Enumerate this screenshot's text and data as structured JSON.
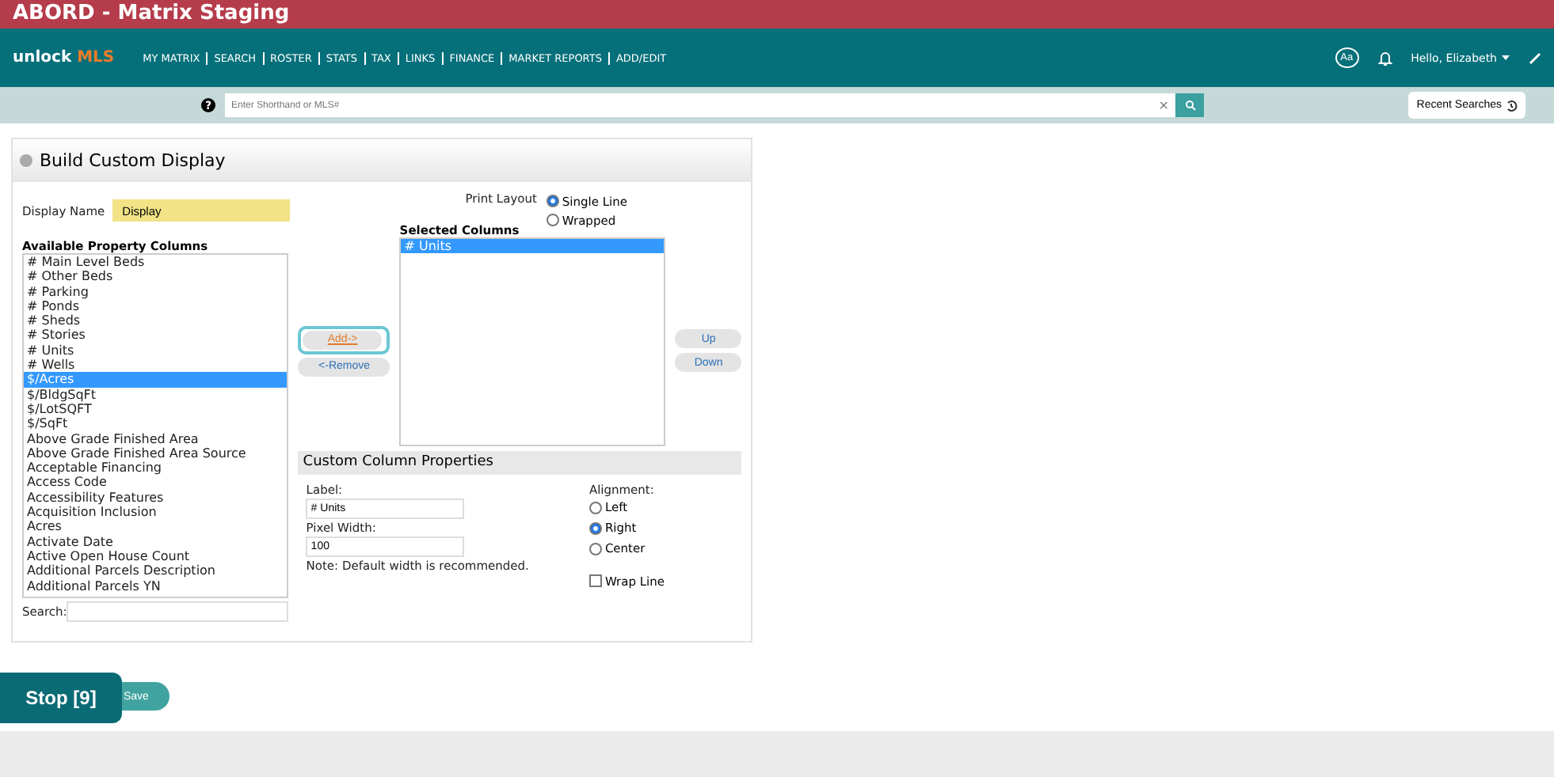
{
  "window": {
    "title": "ABORD - Matrix Staging"
  },
  "nav": {
    "logo_main": "unlock",
    "logo_accent": "MLS",
    "items": [
      "MY MATRIX",
      "SEARCH",
      "ROSTER",
      "STATS",
      "TAX",
      "LINKS",
      "FINANCE",
      "MARKET REPORTS",
      "ADD/EDIT"
    ],
    "font_button": "Aa",
    "user": "Hello, Elizabeth"
  },
  "search": {
    "help": "?",
    "placeholder": "Enter Shorthand or MLS#",
    "clear": "×",
    "recent": "Recent Searches"
  },
  "panel": {
    "title": "Build Custom Display",
    "display_name_label": "Display Name",
    "display_name": "Display",
    "print_layout_label": "Print Layout",
    "print_layouts": [
      {
        "label": "Single Line",
        "selected": true
      },
      {
        "label": "Wrapped",
        "selected": false
      }
    ],
    "available_label": "Available Property Columns",
    "available": [
      {
        "label": "# Main Level Beds",
        "selected": false
      },
      {
        "label": "# Other Beds",
        "selected": false
      },
      {
        "label": "# Parking",
        "selected": false
      },
      {
        "label": "# Ponds",
        "selected": false
      },
      {
        "label": "# Sheds",
        "selected": false
      },
      {
        "label": "# Stories",
        "selected": false
      },
      {
        "label": "# Units",
        "selected": false
      },
      {
        "label": "# Wells",
        "selected": false
      },
      {
        "label": "$/Acres",
        "selected": true
      },
      {
        "label": "$/BldgSqFt",
        "selected": false
      },
      {
        "label": "$/LotSQFT",
        "selected": false
      },
      {
        "label": "$/SqFt",
        "selected": false
      },
      {
        "label": "Above Grade Finished Area",
        "selected": false
      },
      {
        "label": "Above Grade Finished Area Source",
        "selected": false
      },
      {
        "label": "Acceptable Financing",
        "selected": false
      },
      {
        "label": "Access Code",
        "selected": false
      },
      {
        "label": "Accessibility Features",
        "selected": false
      },
      {
        "label": "Acquisition Inclusion",
        "selected": false
      },
      {
        "label": "Acres",
        "selected": false
      },
      {
        "label": "Activate Date",
        "selected": false
      },
      {
        "label": "Active Open House Count",
        "selected": false
      },
      {
        "label": "Additional Parcels Description",
        "selected": false
      },
      {
        "label": "Additional Parcels YN",
        "selected": false
      }
    ],
    "search_label": "Search:",
    "add": "Add->",
    "remove": "<-Remove",
    "selected_label": "Selected Columns",
    "selected": [
      {
        "label": "# Units",
        "selected": true
      }
    ],
    "up": "Up",
    "down": "Down",
    "props_title": "Custom Column Properties",
    "label_label": "Label:",
    "label_value": "# Units",
    "width_label": "Pixel Width:",
    "width_value": "100",
    "note": "Note: Default width is recommended.",
    "alignment_label": "Alignment:",
    "alignments": [
      {
        "label": "Left",
        "selected": false
      },
      {
        "label": "Right",
        "selected": true
      },
      {
        "label": "Center",
        "selected": false
      }
    ],
    "wrap": {
      "label": "Wrap Line",
      "checked": false
    }
  },
  "save": "Save",
  "stop": "Stop [9]"
}
